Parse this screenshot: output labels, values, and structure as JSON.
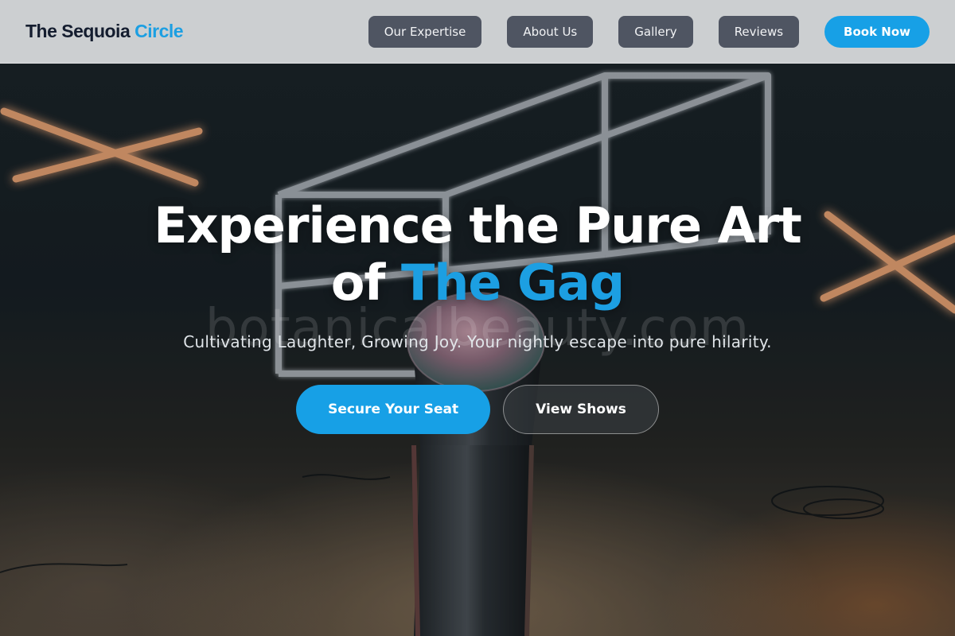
{
  "navbar": {
    "brand_main": "The Sequoia",
    "brand_accent": "Circle",
    "links": [
      {
        "label": "Our Expertise"
      },
      {
        "label": "About Us"
      },
      {
        "label": "Gallery"
      },
      {
        "label": "Reviews"
      }
    ],
    "book_label": "Book Now"
  },
  "hero": {
    "title_line1": "Experience the Pure Art",
    "title_line2_prefix": "of",
    "title_highlight": "The Gag",
    "watermark": "botanicalbeauty.com",
    "subtitle": "Cultivating Laughter, Growing Joy. Your nightly escape into pure hilarity.",
    "primary_cta": "Secure Your Seat",
    "secondary_cta": "View Shows",
    "background_image": "microphone-on-stage-with-neon-lights"
  },
  "colors": {
    "accent": "#1c9fe2",
    "nav_button": "#4f5562",
    "brand_text": "#141d2f",
    "navbar_bg": "#dadddf"
  }
}
